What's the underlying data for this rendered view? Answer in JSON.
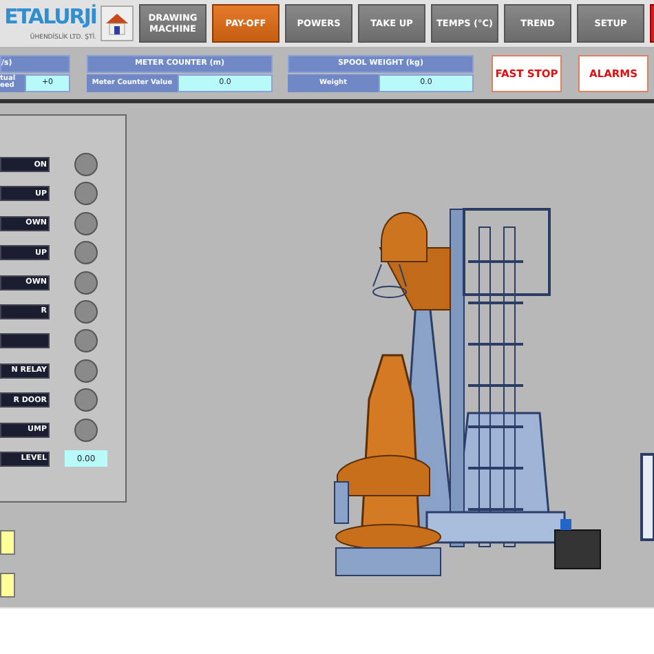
{
  "logo": {
    "name": "ETALURJİ",
    "subtitle": "ÜHENDİSLİK LTD. ŞTİ."
  },
  "nav": [
    {
      "label": "DRAWING MACHINE",
      "kind": "page",
      "selected": false
    },
    {
      "label": "PAY-OFF",
      "kind": "page",
      "selected": true
    },
    {
      "label": "POWERS",
      "kind": "page",
      "selected": false
    },
    {
      "label": "TAKE UP",
      "kind": "page",
      "selected": false
    },
    {
      "label": "TEMPS (°C)",
      "kind": "page",
      "selected": false
    },
    {
      "label": "TREND",
      "kind": "page",
      "selected": false
    },
    {
      "label": "SETUP",
      "kind": "page",
      "selected": false
    },
    {
      "kind": "alert"
    }
  ],
  "speed_panel": {
    "title": "/s)",
    "label": "tual eed",
    "value": "+0"
  },
  "meter_counter": {
    "title": "METER COUNTER (m)",
    "label": "Meter Counter Value",
    "value": "0.0"
  },
  "spool_weight": {
    "title": "SPOOL WEIGHT (kg)",
    "label": "Weight",
    "value": "0.0"
  },
  "actions": [
    "FAST STOP",
    "ALARMS"
  ],
  "signals": [
    {
      "label": "ON",
      "kind": "lamp",
      "on": false
    },
    {
      "label": "UP",
      "kind": "lamp",
      "on": false
    },
    {
      "label": "OWN",
      "kind": "lamp",
      "on": false
    },
    {
      "label": "UP",
      "kind": "lamp",
      "on": false
    },
    {
      "label": "OWN",
      "kind": "lamp",
      "on": false
    },
    {
      "label": "R",
      "kind": "lamp",
      "on": false
    },
    {
      "kind": "lamp",
      "on": false
    },
    {
      "label": "N RELAY",
      "kind": "lamp",
      "on": false
    },
    {
      "label": "R DOOR",
      "kind": "lamp",
      "on": false
    },
    {
      "label": "UMP",
      "kind": "lamp",
      "on": false
    },
    {
      "label": "LEVEL",
      "kind": "value",
      "value": "0.00"
    }
  ],
  "side_buttons": [
    {
      "kind": "button"
    },
    {
      "kind": "button"
    }
  ]
}
